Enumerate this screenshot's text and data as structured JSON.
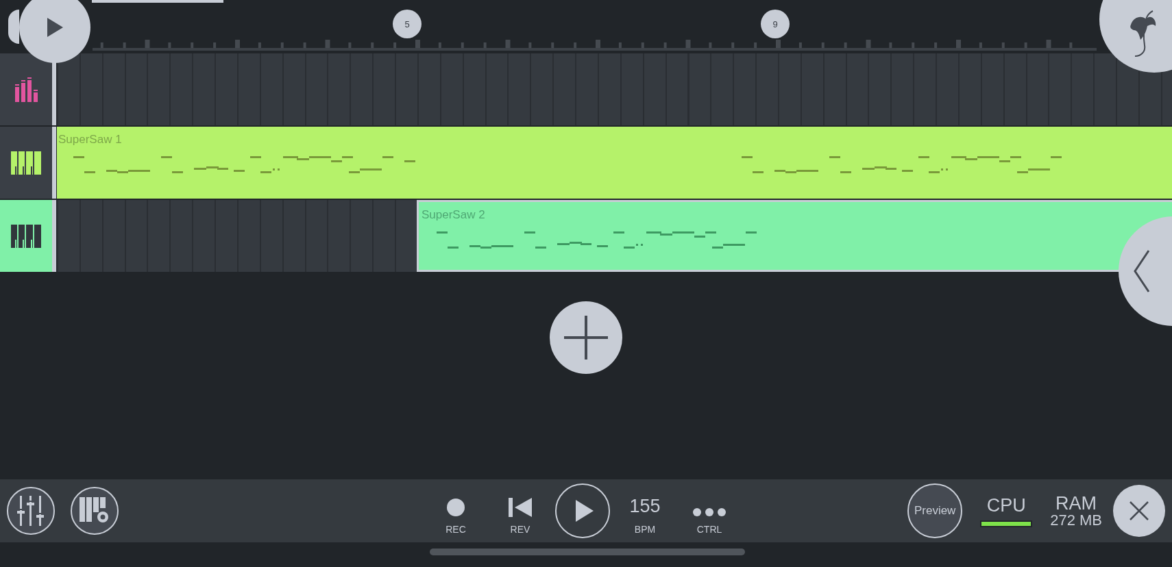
{
  "ruler": {
    "markers": [
      "5",
      "9"
    ]
  },
  "tracks": [
    {
      "kind": "automation",
      "selected": false
    },
    {
      "kind": "pattern",
      "selected": false,
      "clip": {
        "name": "SuperSaw 1",
        "color": "#b5f26a"
      }
    },
    {
      "kind": "pattern",
      "selected": true,
      "clip": {
        "name": "SuperSaw 2",
        "color": "#80f0a8"
      }
    }
  ],
  "transport": {
    "rec": "REC",
    "rev": "REV",
    "tempo": "155",
    "tempo_label": "BPM",
    "ctrl": "CTRL",
    "preview": "Preview"
  },
  "cpu": {
    "label": "CPU",
    "level": 1
  },
  "ram": {
    "label": "RAM",
    "value": "272 MB"
  }
}
